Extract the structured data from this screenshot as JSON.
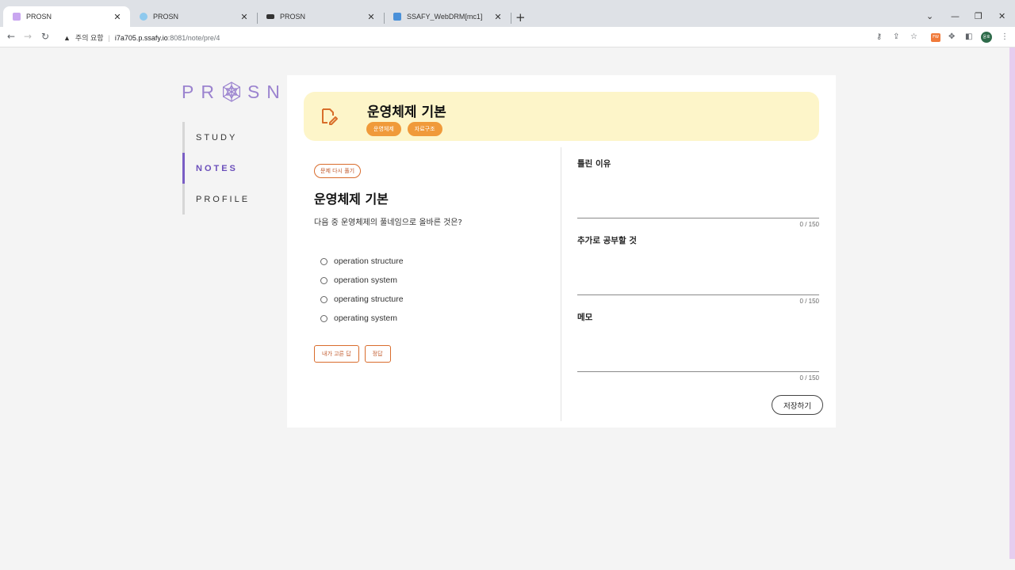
{
  "browser": {
    "tabs": [
      {
        "label": "PROSN",
        "favicon_color": "#c9a6f0"
      },
      {
        "label": "PROSN",
        "favicon_color": "#8ec9ee"
      },
      {
        "label": "PROSN",
        "favicon_color": "#333333"
      },
      {
        "label": "SSAFY_WebDRM[mc1]",
        "favicon_color": "#4a90d9"
      }
    ],
    "new_tab": "+",
    "url_warning": "주의 요함",
    "url_host": "i7a705.p.ssafy.io",
    "url_path": ":8081/note/pre/4",
    "profile_initials": "윤호",
    "extension_label": "FW"
  },
  "sidebar": {
    "logo_left": "PR",
    "logo_right": "SN",
    "items": [
      {
        "label": "STUDY",
        "active": false
      },
      {
        "label": "NOTES",
        "active": true
      },
      {
        "label": "PROFILE",
        "active": false
      }
    ]
  },
  "banner": {
    "title": "운영체제 기본",
    "tags": [
      "운영체제",
      "자료구조"
    ]
  },
  "question": {
    "retry_label": "문제 다시 풀기",
    "title": "운영체제 기본",
    "text": "다음 중 운영체제의 풀네임으로 올바른 것은?",
    "options": [
      "operation structure",
      "operation system",
      "operating structure",
      "operating system"
    ],
    "my_answer_label": "내가 고른 답",
    "answer_label": "정답"
  },
  "note_fields": [
    {
      "label": "틀린 이유",
      "count": "0 / 150"
    },
    {
      "label": "추가로 공부할 것",
      "count": "0 / 150"
    },
    {
      "label": "메모",
      "count": "0 / 150"
    }
  ],
  "save_label": "저장하기",
  "colors": {
    "accent_purple": "#7a5ec5",
    "tag_orange": "#f09a3a",
    "banner_bg": "#fdf5c9"
  }
}
